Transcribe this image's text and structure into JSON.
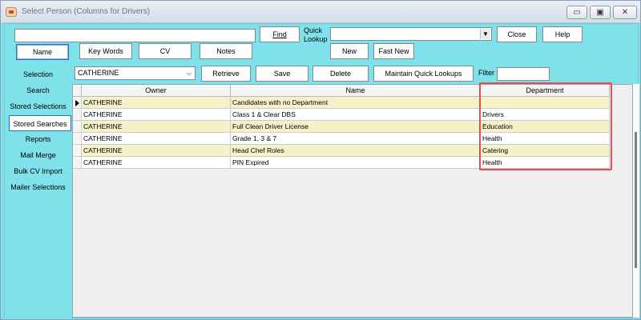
{
  "window": {
    "title": "Select Person (Columns for Drivers)",
    "controls": {
      "minimize": "▭",
      "maximize": "▣",
      "close": "✕"
    }
  },
  "toolbar": {
    "search_value": "",
    "find_label": "Find",
    "quick_lookup_label_1": "Quick",
    "quick_lookup_label_2": "Lookup",
    "quick_lookup_value": "",
    "close_label": "Close",
    "help_label": "Help",
    "new_label": "New",
    "fast_new_label": "Fast New",
    "tabs": [
      {
        "label": "Name",
        "active": true
      },
      {
        "label": "Key Words",
        "active": false
      },
      {
        "label": "CV",
        "active": false
      },
      {
        "label": "Notes",
        "active": false
      }
    ]
  },
  "searches_bar": {
    "owner_value": "CATHERINE",
    "retrieve_label": "Retrieve",
    "save_label": "Save",
    "delete_label": "Delete",
    "maintain_label": "Maintain Quick Lookups",
    "filter_label": "Filter",
    "filter_value": ""
  },
  "sidebar": {
    "items": [
      {
        "label": "Selection",
        "active": false
      },
      {
        "label": "Search",
        "active": false
      },
      {
        "label": "Stored Selections",
        "active": false
      },
      {
        "label": "Stored Searches",
        "active": true
      },
      {
        "label": "Reports",
        "active": false
      },
      {
        "label": "Mail Merge",
        "active": false
      },
      {
        "label": "Bulk CV Import",
        "active": false
      },
      {
        "label": "Mailer Selections",
        "active": false
      }
    ]
  },
  "grid": {
    "columns": [
      "Owner",
      "Name",
      "Department"
    ],
    "rows": [
      {
        "owner": "CATHERINE",
        "name": "Candidates with no Department",
        "department": ""
      },
      {
        "owner": "CATHERINE",
        "name": "Class 1 & Clear DBS",
        "department": "Drivers"
      },
      {
        "owner": "CATHERINE",
        "name": "Full Clean Driver License",
        "department": "Education"
      },
      {
        "owner": "CATHERINE",
        "name": "Grade 1, 3 & 7",
        "department": "Health"
      },
      {
        "owner": "CATHERINE",
        "name": "Head Chef Roles",
        "department": "Catering"
      },
      {
        "owner": "CATHERINE",
        "name": "PIN Expired",
        "department": "Health"
      }
    ]
  },
  "colors": {
    "panel_bg": "#7fe2ea",
    "row_alt": "#f6f2c8",
    "highlight": "#e05050"
  }
}
